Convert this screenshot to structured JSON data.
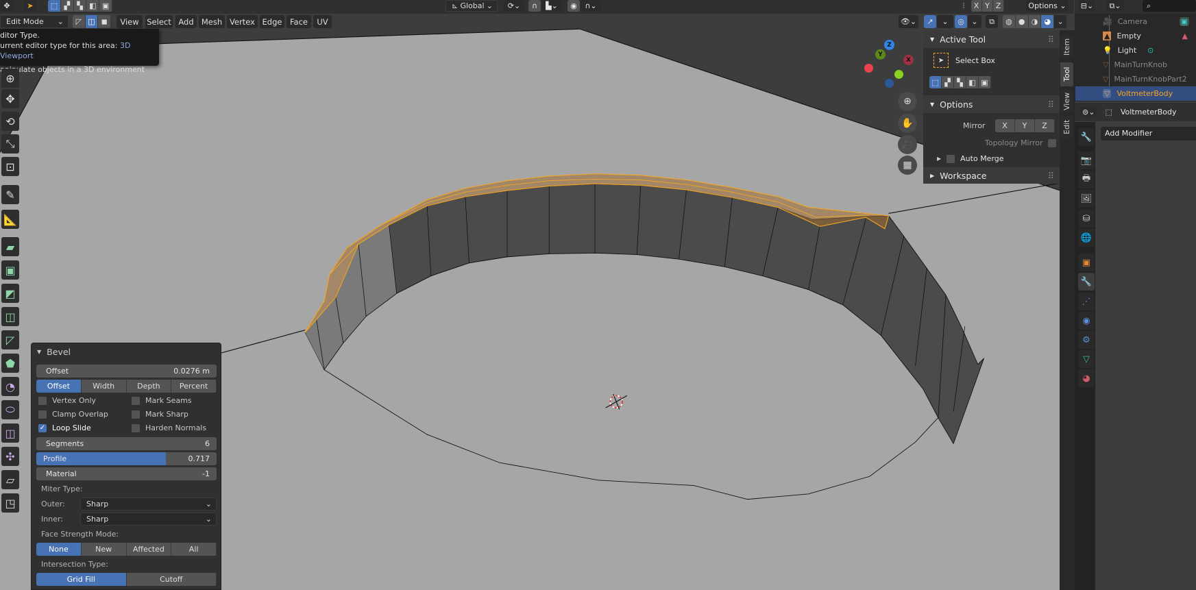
{
  "header": {
    "select_modes": [
      "select-new",
      "extend",
      "subtract",
      "invert",
      "intersect"
    ],
    "mode_dropdown": "Edit Mode",
    "menus": [
      "View",
      "Select",
      "Add",
      "Mesh",
      "Vertex",
      "Edge",
      "Face",
      "UV"
    ],
    "transform_orientation": "Global",
    "mirror_axes": [
      "X",
      "Y",
      "Z"
    ],
    "options_label": "Options"
  },
  "tooltip": {
    "line1": "ditor Type.",
    "line2_prefix": "urrent editor type for this area:",
    "line2_value": "3D Viewport",
    "line3": "anipulate objects in a 3D environment",
    "value_color": "#8fa9dd"
  },
  "toolbar": {
    "tools": [
      "cursor-icon",
      "move-icon",
      "rotate-icon",
      "scale-icon",
      "transform-icon",
      "annotate-icon",
      "measure-icon",
      "extrude-icon",
      "inset-icon",
      "bevel-icon",
      "loop-cut-icon",
      "knife-icon",
      "poly-build-icon",
      "spin-icon",
      "smooth-icon",
      "edge-slide-icon",
      "shrink-fatten-icon",
      "shear-icon",
      "rip-icon"
    ]
  },
  "npanel": {
    "tabs": [
      "Item",
      "Tool",
      "View",
      "Edit"
    ],
    "active_tab": "Tool",
    "active_tool": {
      "title": "Active Tool",
      "tool_name": "Select Box"
    },
    "options": {
      "title": "Options",
      "mirror_label": "Mirror",
      "mirror_axes": [
        "X",
        "Y",
        "Z"
      ],
      "topology_mirror": "Topology Mirror",
      "auto_merge": "Auto Merge"
    },
    "workspace": {
      "title": "Workspace"
    }
  },
  "outliner": {
    "items": [
      {
        "name": "Camera",
        "icon": "camera-icon"
      },
      {
        "name": "Empty",
        "icon": "empty-image-icon"
      },
      {
        "name": "Light",
        "icon": "light-icon"
      },
      {
        "name": "MainTurnKnob",
        "icon": "mesh-icon"
      },
      {
        "name": "MainTurnKnobPart2",
        "icon": "mesh-icon"
      },
      {
        "name": "VoltmeterBody",
        "icon": "mesh-icon",
        "selected": true
      }
    ]
  },
  "properties": {
    "object_name": "VoltmeterBody",
    "add_modifier": "Add Modifier",
    "tabs": [
      "tool",
      "render",
      "output",
      "view-layer",
      "scene",
      "world",
      "object",
      "modifiers",
      "particles",
      "physics",
      "constraints",
      "data",
      "material"
    ],
    "active_tab": "modifiers"
  },
  "bevel": {
    "title": "Bevel",
    "offset_label": "Offset",
    "offset_value": "0.0276 m",
    "width_types": [
      "Offset",
      "Width",
      "Depth",
      "Percent"
    ],
    "width_type_active": "Offset",
    "checkboxes": [
      {
        "label": "Vertex Only",
        "checked": false
      },
      {
        "label": "Mark Seams",
        "checked": false
      },
      {
        "label": "Clamp Overlap",
        "checked": false
      },
      {
        "label": "Mark Sharp",
        "checked": false
      },
      {
        "label": "Loop Slide",
        "checked": true
      },
      {
        "label": "Harden Normals",
        "checked": false
      }
    ],
    "segments_label": "Segments",
    "segments_value": "6",
    "profile_label": "Profile",
    "profile_value": "0.717",
    "profile_fraction": 0.717,
    "material_label": "Material",
    "material_value": "-1",
    "miter_type_label": "Miter Type:",
    "outer_label": "Outer:",
    "outer_value": "Sharp",
    "inner_label": "Inner:",
    "inner_value": "Sharp",
    "face_strength_label": "Face Strength Mode:",
    "face_strength_modes": [
      "None",
      "New",
      "Affected",
      "All"
    ],
    "face_strength_active": "None",
    "intersection_label": "Intersection Type:",
    "intersection_types": [
      "Grid Fill",
      "Cutoff"
    ],
    "intersection_active": "Grid Fill"
  },
  "gizmo": {
    "x": "X",
    "y": "Y",
    "z": "Z",
    "colors": {
      "x": "#e8434e",
      "y": "#8bd11f",
      "z": "#2f86e8"
    }
  },
  "colors": {
    "accent": "#4772b3",
    "selection": "#f5a623"
  }
}
